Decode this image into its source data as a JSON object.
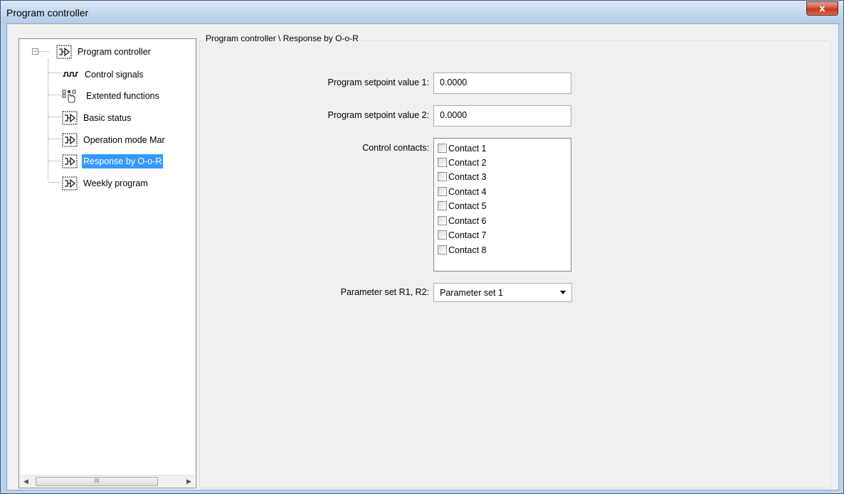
{
  "window": {
    "title": "Program controller",
    "close_label": "x"
  },
  "tree": {
    "root": {
      "label": "Program controller",
      "icon": "program-controller-icon"
    },
    "items": [
      {
        "label": "Control signals",
        "icon": "pulse-signal-icon"
      },
      {
        "label": "Extented functions",
        "icon": "hand-pointer-icon"
      },
      {
        "label": "Basic status",
        "icon": "program-controller-icon"
      },
      {
        "label": "Operation mode Mar",
        "icon": "program-controller-icon"
      },
      {
        "label": "Response by O-o-R",
        "icon": "program-controller-icon",
        "selected": true
      },
      {
        "label": "Weekly program",
        "icon": "program-controller-icon"
      }
    ],
    "scroll_thumb_label": "III"
  },
  "panel": {
    "title": "Program controller \\ Response by O-o-R",
    "setpoint1": {
      "label": "Program setpoint value 1:",
      "value": "0.0000"
    },
    "setpoint2": {
      "label": "Program setpoint value 2:",
      "value": "0.0000"
    },
    "contacts": {
      "label": "Control contacts:",
      "items": [
        "Contact 1",
        "Contact 2",
        "Contact 3",
        "Contact 4",
        "Contact 5",
        "Contact 6",
        "Contact 7",
        "Contact 8"
      ]
    },
    "parameter_set": {
      "label": "Parameter set R1, R2:",
      "value": "Parameter set 1"
    }
  }
}
